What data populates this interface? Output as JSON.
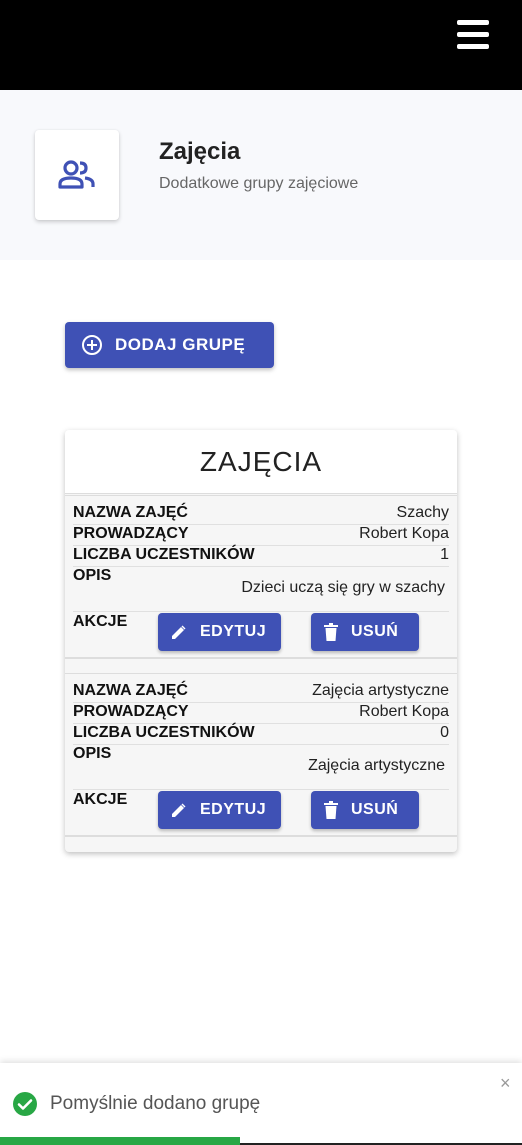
{
  "header": {
    "title": "Zajęcia",
    "subtitle": "Dodatkowe grupy zajęciowe",
    "icon": "people-icon"
  },
  "toolbar": {
    "add_label": "DODAJ GRUPĘ"
  },
  "card": {
    "title": "ZAJĘCIA",
    "labels": {
      "name": "NAZWA ZAJĘĆ",
      "teacher": "PROWADZĄCY",
      "count": "LICZBA UCZESTNIKÓW",
      "description": "OPIS",
      "actions": "AKCJE"
    },
    "edit_label": "EDYTUJ",
    "delete_label": "USUŃ",
    "groups": [
      {
        "name": "Szachy",
        "teacher": "Robert Kopa",
        "count": "1",
        "description": "Dzieci uczą się gry w szachy"
      },
      {
        "name": "Zajęcia artystyczne",
        "teacher": "Robert Kopa",
        "count": "0",
        "description": "Zajęcia artystyczne"
      }
    ]
  },
  "toast": {
    "message": "Pomyślnie dodano grupę",
    "close": "×",
    "progress": 0.46
  },
  "colors": {
    "primary": "#3f51b5",
    "success": "#28a745",
    "topbar": "#000000"
  }
}
